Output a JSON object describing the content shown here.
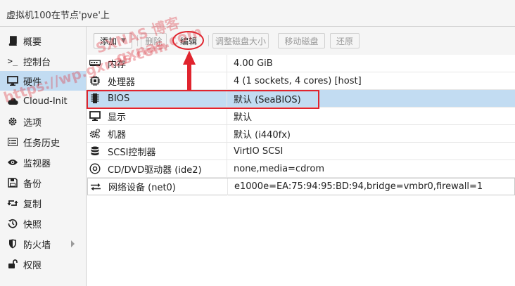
{
  "window": {
    "title": "虚拟机100在节点'pve'上"
  },
  "sidebar": {
    "items": [
      {
        "label": "概要",
        "icon": "book-icon"
      },
      {
        "label": "控制台",
        "icon": "terminal-icon"
      },
      {
        "label": "硬件",
        "icon": "monitor-icon",
        "active": true
      },
      {
        "label": "Cloud-Init",
        "icon": "cloud-icon"
      },
      {
        "label": "选项",
        "icon": "gear-icon"
      },
      {
        "label": "任务历史",
        "icon": "list-icon"
      },
      {
        "label": "监视器",
        "icon": "eye-icon"
      },
      {
        "label": "备份",
        "icon": "floppy-icon"
      },
      {
        "label": "复制",
        "icon": "retweet-icon"
      },
      {
        "label": "快照",
        "icon": "history-icon"
      },
      {
        "label": "防火墙",
        "icon": "shield-icon",
        "has_submenu": true
      },
      {
        "label": "权限",
        "icon": "unlock-icon"
      }
    ]
  },
  "toolbar": {
    "add_label": "添加",
    "remove_label": "删除",
    "edit_label": "编辑",
    "resize_label": "调整磁盘大小",
    "move_label": "移动磁盘",
    "revert_label": "还原"
  },
  "hardware": {
    "rows": [
      {
        "key": "内存",
        "value": "4.00 GiB",
        "icon": "memory-icon"
      },
      {
        "key": "处理器",
        "value": "4 (1 sockets, 4 cores) [host]",
        "icon": "cpu-icon"
      },
      {
        "key": "BIOS",
        "value": "默认 (SeaBIOS)",
        "icon": "microchip-icon",
        "selected": true
      },
      {
        "key": "显示",
        "value": "默认",
        "icon": "desktop-icon"
      },
      {
        "key": "机器",
        "value": "默认 (i440fx)",
        "icon": "cogs-icon"
      },
      {
        "key": "SCSI控制器",
        "value": "VirtIO SCSI",
        "icon": "database-icon"
      },
      {
        "key": "CD/DVD驱动器 (ide2)",
        "value": "none,media=cdrom",
        "icon": "cdrom-icon"
      },
      {
        "key": "网络设备 (net0)",
        "value": "e1000e=EA:75:94:95:BD:94,bridge=vmbr0,firewall=1",
        "icon": "exchange-icon"
      }
    ]
  },
  "watermarks": {
    "line1": "SXNAS 博客",
    "line2": "gxnas.com",
    "line3": "https://wp.gxnas.com"
  },
  "colors": {
    "selection": "#c2dcf2",
    "annotation": "#e0242e"
  }
}
